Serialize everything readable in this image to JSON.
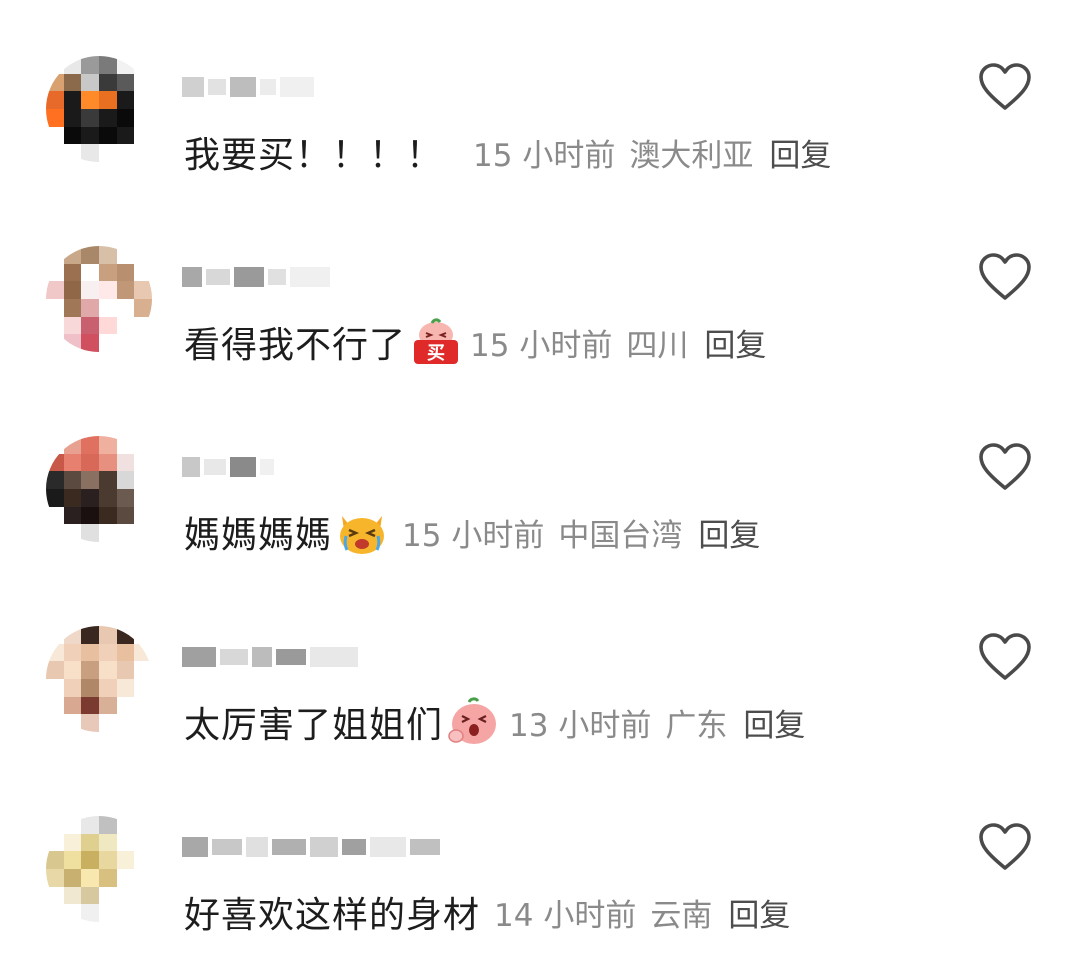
{
  "comments": [
    {
      "text": "我要买！！！！",
      "sticker": "",
      "time": "15 小时前",
      "location": "澳大利亚",
      "reply": "回复",
      "avatar_colors": [
        "#ffffff",
        "#e8e8e8",
        "#9a9a9a",
        "#7a7a7a",
        "#f2f2f2",
        "#ffffff",
        "#d9a070",
        "#8a6a4a",
        "#c8c8c8",
        "#3a3a3a",
        "#5a5a5a",
        "#ffffff",
        "#e86a2a",
        "#1a1a1a",
        "#ff8a2a",
        "#e87020",
        "#1a1a1a",
        "#ffffff",
        "#ff7020",
        "#1a1a1a",
        "#3a3a3a",
        "#1a1a1a",
        "#0a0a0a",
        "#ffffff",
        "#ffffff",
        "#0a0a0a",
        "#1a1a1a",
        "#0a0a0a",
        "#1a1a1a",
        "#ffffff",
        "#ffffff",
        "#ffffff",
        "#e8e8e8",
        "#ffffff",
        "#ffffff",
        "#ffffff"
      ],
      "username_blocks": [
        "#d0d0d0",
        "#e2e2e2",
        "#bdbdbd",
        "#ececec",
        "#f0f0f0"
      ]
    },
    {
      "text": "看得我不行了",
      "sticker": "buy-sticker",
      "time": "15 小时前",
      "location": "四川",
      "reply": "回复",
      "avatar_colors": [
        "#ffffff",
        "#c8a888",
        "#a88868",
        "#d8c0a8",
        "#ffffff",
        "#ffffff",
        "#ffffff",
        "#9a7050",
        "#ffffff",
        "#c8a080",
        "#b89070",
        "#ffffff",
        "#f0c8c8",
        "#906848",
        "#f8f0f0",
        "#ffe8e8",
        "#c09878",
        "#e8c8b0",
        "#ffffff",
        "#a07858",
        "#e0a8a8",
        "#ffffff",
        "#ffffff",
        "#d8b090",
        "#ffffff",
        "#f8d8d8",
        "#c86070",
        "#ffd8d8",
        "#ffffff",
        "#ffffff",
        "#ffffff",
        "#f0c0c8",
        "#d05060",
        "#ffffff",
        "#ffffff",
        "#ffffff"
      ],
      "username_blocks": [
        "#a8a8a8",
        "#d8d8d8",
        "#9a9a9a",
        "#e0e0e0",
        "#f0f0f0"
      ]
    },
    {
      "text": "媽媽媽媽",
      "sticker": "crying-cat-sticker",
      "time": "15 小时前",
      "location": "中国台湾",
      "reply": "回复",
      "avatar_colors": [
        "#ffffff",
        "#e8a090",
        "#e07060",
        "#f0b0a0",
        "#ffffff",
        "#ffffff",
        "#c85848",
        "#e88070",
        "#d86858",
        "#e89080",
        "#f0e0e0",
        "#ffffff",
        "#2a2a2a",
        "#5a4a40",
        "#8a7060",
        "#4a3a30",
        "#d8d8d8",
        "#ffffff",
        "#1a1a1a",
        "#3a2a20",
        "#2a2020",
        "#4a3a30",
        "#6a5a50",
        "#ffffff",
        "#ffffff",
        "#2a2020",
        "#1a1010",
        "#3a2a20",
        "#5a4a40",
        "#ffffff",
        "#ffffff",
        "#ffffff",
        "#e0e0e0",
        "#ffffff",
        "#ffffff",
        "#ffffff"
      ],
      "username_blocks": [
        "#c8c8c8",
        "#e8e8e8",
        "#8a8a8a",
        "#f0f0f0",
        "#ffffff"
      ]
    },
    {
      "text": "太厉害了姐姐们",
      "sticker": "shocked-peach-sticker",
      "time": "13 小时前",
      "location": "广东",
      "reply": "回复",
      "avatar_colors": [
        "#ffffff",
        "#f0d8c8",
        "#3a2820",
        "#e8c8b0",
        "#3a2820",
        "#ffffff",
        "#f8e8d8",
        "#f0d0b8",
        "#e8c0a0",
        "#f0d0b8",
        "#e8c0a0",
        "#f8e8d8",
        "#e8c8b0",
        "#f8e0c8",
        "#c8a080",
        "#f8e0c8",
        "#e8c8b0",
        "#ffffff",
        "#ffffff",
        "#f0d0b8",
        "#b08868",
        "#f0d0b8",
        "#f8e8d8",
        "#ffffff",
        "#ffffff",
        "#d8a890",
        "#7a3a30",
        "#d8b098",
        "#ffffff",
        "#ffffff",
        "#ffffff",
        "#ffffff",
        "#e8c8b8",
        "#ffffff",
        "#ffffff",
        "#ffffff"
      ],
      "username_blocks": [
        "#a0a0a0",
        "#d8d8d8",
        "#bcbcbc",
        "#9a9a9a",
        "#e8e8e8"
      ]
    },
    {
      "text": "好喜欢这样的身材",
      "sticker": "",
      "time": "14 小时前",
      "location": "云南",
      "reply": "回复",
      "avatar_colors": [
        "#ffffff",
        "#ffffff",
        "#e8e8e8",
        "#c0c0c0",
        "#ffffff",
        "#ffffff",
        "#ffffff",
        "#f8f0d8",
        "#e0d090",
        "#f0e8c0",
        "#ffffff",
        "#ffffff",
        "#d8c890",
        "#f0e0a0",
        "#c8b060",
        "#e8d8a0",
        "#f8f0d8",
        "#ffffff",
        "#e8d8a8",
        "#c8b070",
        "#f8e8b0",
        "#d8c080",
        "#ffffff",
        "#ffffff",
        "#ffffff",
        "#f0e8d0",
        "#d8c8a0",
        "#ffffff",
        "#ffffff",
        "#ffffff",
        "#ffffff",
        "#ffffff",
        "#f0f0f0",
        "#ffffff",
        "#ffffff",
        "#ffffff"
      ],
      "username_blocks": [
        "#a8a8a8",
        "#c8c8c8",
        "#e0e0e0",
        "#b0b0b0",
        "#d0d0d0",
        "#a0a0a0",
        "#e8e8e8",
        "#c0c0c0"
      ]
    }
  ],
  "icons": {
    "like": "heart-outline-icon",
    "like_color": "#4a4a4a"
  }
}
